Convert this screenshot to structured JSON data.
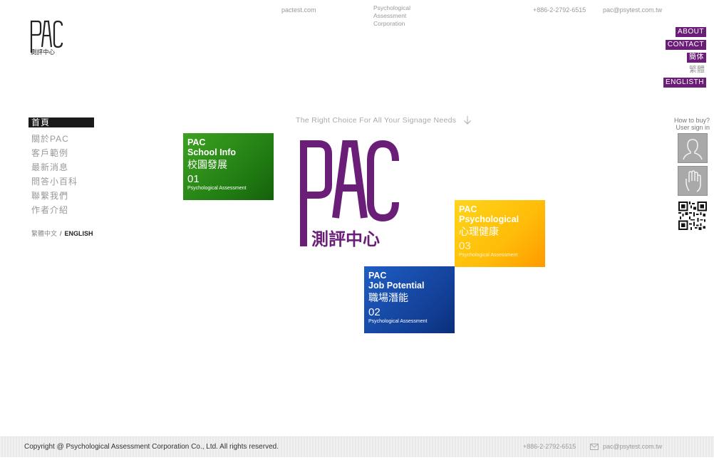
{
  "header": {
    "logo_text": "PAC",
    "logo_sub": "測評中心",
    "site_link": "pactest.com",
    "corp_name_lines": [
      "Psychological",
      "Assessment",
      "Corporation"
    ],
    "phone": "+886-2-2792-6515",
    "email": "pac@psytest.com.tw"
  },
  "right_menu": {
    "about": "ABOUT",
    "contact": "CONTACT",
    "simplified": "簡体",
    "traditional": "繁體",
    "english": "ENGLISTH"
  },
  "left_nav": {
    "items": [
      "首頁",
      "關於PAC",
      "客戶範例",
      "最新消息",
      "問答小百科",
      "聯繫我們",
      "作者介紹"
    ],
    "lang_zh": "繁體中文",
    "lang_sep": "/",
    "lang_en": "ENGLISH"
  },
  "tagline": "The Right Choice For All Your Signage Needs",
  "big_logo": {
    "text": "PAC",
    "sub": "測評中心",
    "color": "#6b1e78"
  },
  "tiles": {
    "school": {
      "line1": "PAC",
      "line2": "School Info",
      "line3": "校園發展",
      "num": "01",
      "sub": "Psychological Assessment",
      "color": "#2a8a18"
    },
    "psych": {
      "line1": "PAC",
      "line2": "Psychological",
      "line3": "心理健康",
      "num": "03",
      "sub": "Psychological Assessment",
      "color": "#ffb80a"
    },
    "job": {
      "line1": "PAC",
      "line2": "Job Potential",
      "line3": "職場潛能",
      "num": "02",
      "sub": "Psychological Assessment",
      "color": "#154aa8"
    }
  },
  "side": {
    "how_to_buy": "How to buy?",
    "user_sign_in": "User sign in"
  },
  "footer": {
    "copyright": "Copyright @ Psychological Assessment Corporation Co., Ltd. All rights reserved.",
    "phone": "+886-2-2792-6515",
    "email": "pac@psytest.com.tw"
  }
}
